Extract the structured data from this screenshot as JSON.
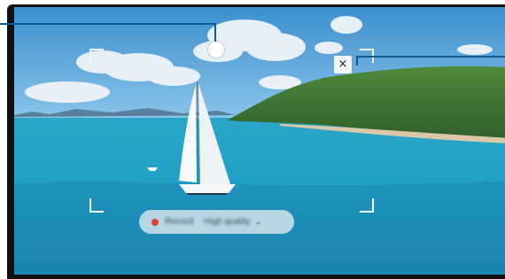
{
  "screen": {
    "close_icon_glyph": "×",
    "recording_bar": {
      "record_label": "Record",
      "quality_label": "High quality",
      "chevron_glyph": "⌄",
      "indicator_color": "#e23b3b"
    }
  },
  "colors": {
    "callout_line": "#0b5e8f",
    "frame_corners": "#f2f6f8"
  }
}
